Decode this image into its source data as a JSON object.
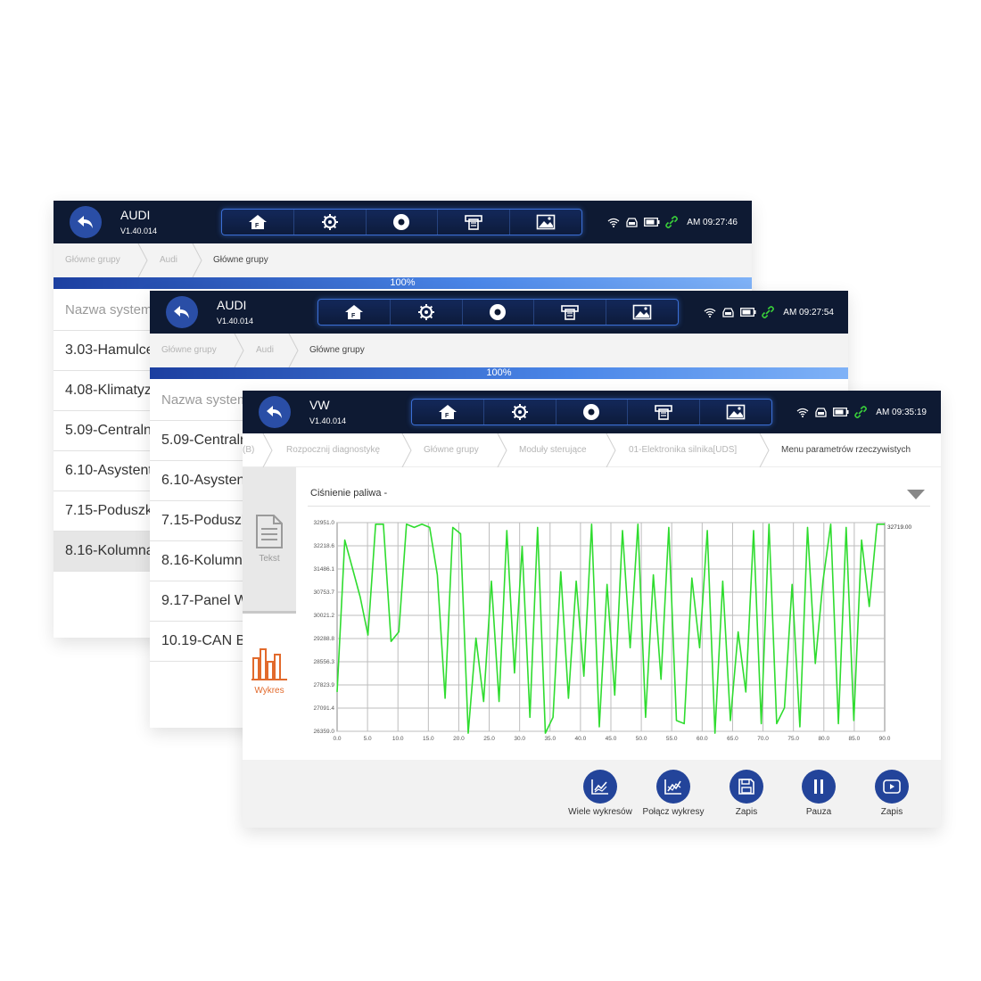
{
  "windows": [
    {
      "app_name": "AUDI",
      "version": "V1.40.014",
      "time": "AM 09:27:46",
      "breadcrumb": [
        "Główne grupy",
        "Audi",
        "Główne grupy"
      ],
      "progress_label": "100%",
      "list_header": "Nazwa systemu",
      "rows": [
        "3.03-Hamulce",
        "4.08-Klimatyzacja",
        "5.09-Centralny",
        "6.10-Asystent",
        "7.15-Poduszki",
        "8.16-Kolumna"
      ]
    },
    {
      "app_name": "AUDI",
      "version": "V1.40.014",
      "time": "AM 09:27:54",
      "breadcrumb": [
        "Główne grupy",
        "Audi",
        "Główne grupy"
      ],
      "progress_label": "100%",
      "list_header": "Nazwa systemu",
      "rows": [
        "5.09-Centralny",
        "6.10-Asystent",
        "7.15-Poduszki",
        "8.16-Kolumna",
        "9.17-Panel W",
        "10.19-CAN B"
      ]
    },
    {
      "app_name": "VW",
      "version": "V1.40.014",
      "time": "AM 09:35:19",
      "breadcrumb": [
        "(B)",
        "Rozpocznij diagnostykę",
        "Główne grupy",
        "Moduły sterujące",
        "01-Elektronika silnika[UDS]",
        "Menu parametrów rzeczywistych"
      ],
      "tabs": [
        "Tekst",
        "Wykres"
      ],
      "parameter_select": "Ciśnienie paliwa -",
      "actions": [
        "Wiele wykresów",
        "Połącz wykresy",
        "Zapis",
        "Pauza",
        "Zapis"
      ]
    }
  ],
  "toolbar_icons": [
    "home-icon",
    "settings-icon",
    "record-icon",
    "print-icon",
    "image-icon"
  ],
  "status_icons": [
    "wifi-icon",
    "car-icon",
    "battery-icon",
    "link-icon"
  ],
  "colors": {
    "topbar": "#0e1a33",
    "accent": "#23449a",
    "line": "#2fdc2f",
    "selected_tab_icon": "#e26a2c"
  },
  "chart_data": {
    "type": "line",
    "series": [
      {
        "values": [
          27600,
          32400,
          31500,
          30600,
          29400,
          32900,
          32900,
          29200,
          29500,
          32900,
          32800,
          32900,
          32800,
          31300,
          27400,
          32800,
          32600,
          26300,
          29300,
          27300,
          31100,
          27300,
          32700,
          28200,
          32200,
          26800,
          32800,
          26300,
          26800,
          31400,
          27400,
          31100,
          28100,
          32900,
          26500,
          31000,
          27500,
          32700,
          29000,
          32900,
          26800,
          31300,
          28000,
          32800,
          26700,
          26600,
          31200,
          29000,
          32700,
          26300,
          31100,
          26700,
          29500,
          27600,
          32700,
          26600,
          32900,
          26600,
          27100,
          31000,
          26500,
          32800,
          28500,
          31100,
          32900,
          26600,
          32800,
          26700,
          32400,
          30300,
          32900,
          32900
        ],
        "last_value_label": "32719.00"
      }
    ],
    "xlim": [
      0,
      90
    ],
    "x_ticks": [
      "0.0",
      "5.0",
      "10.0",
      "15.0",
      "20.0",
      "25.0",
      "30.0",
      "35.0",
      "40.0",
      "45.0",
      "50.0",
      "55.0",
      "60.0",
      "65.0",
      "70.0",
      "75.0",
      "80.0",
      "85.0",
      "90.0"
    ],
    "y_ticks": [
      "32951.0",
      "32218.6",
      "31486.1",
      "30753.7",
      "30021.2",
      "29288.8",
      "28556.3",
      "27823.9",
      "27091.4",
      "26359.0"
    ],
    "ylim": [
      26359.0,
      32951.0
    ],
    "grid": true
  }
}
